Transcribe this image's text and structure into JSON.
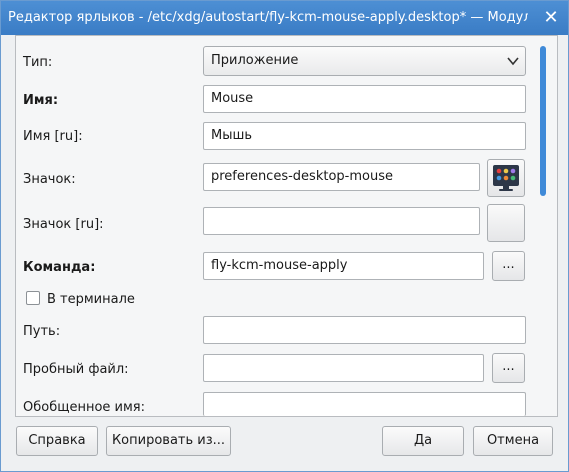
{
  "window": {
    "title": "Редактор ярлыков - /etc/xdg/autostart/fly-kcm-mouse-apply.desktop* — Модуль...",
    "close_icon": "close-icon"
  },
  "form": {
    "type_label": "Тип:",
    "type_value": "Приложение",
    "name_label": "Имя:",
    "name_value": "Mouse",
    "name_ru_label": "Имя [ru]:",
    "name_ru_value": "Мышь",
    "icon_label": "Значок:",
    "icon_value": "preferences-desktop-mouse",
    "icon_ru_label": "Значок [ru]:",
    "icon_ru_value": "",
    "command_label": "Команда:",
    "command_value": "fly-kcm-mouse-apply",
    "browse_label": "...",
    "terminal_label": "В терминале",
    "terminal_checked": false,
    "path_label": "Путь:",
    "path_value": "",
    "tryexec_label": "Пробный файл:",
    "tryexec_value": "",
    "generic_label": "Обобщенное имя:",
    "generic_value": ""
  },
  "buttons": {
    "help": "Справка",
    "copy_from": "Копировать из...",
    "ok": "Да",
    "cancel": "Отмена"
  },
  "colors": {
    "titlebar": "#3f82cc",
    "scroll_thumb": "#3f8ad8",
    "icon_bg": "#2d3748"
  }
}
